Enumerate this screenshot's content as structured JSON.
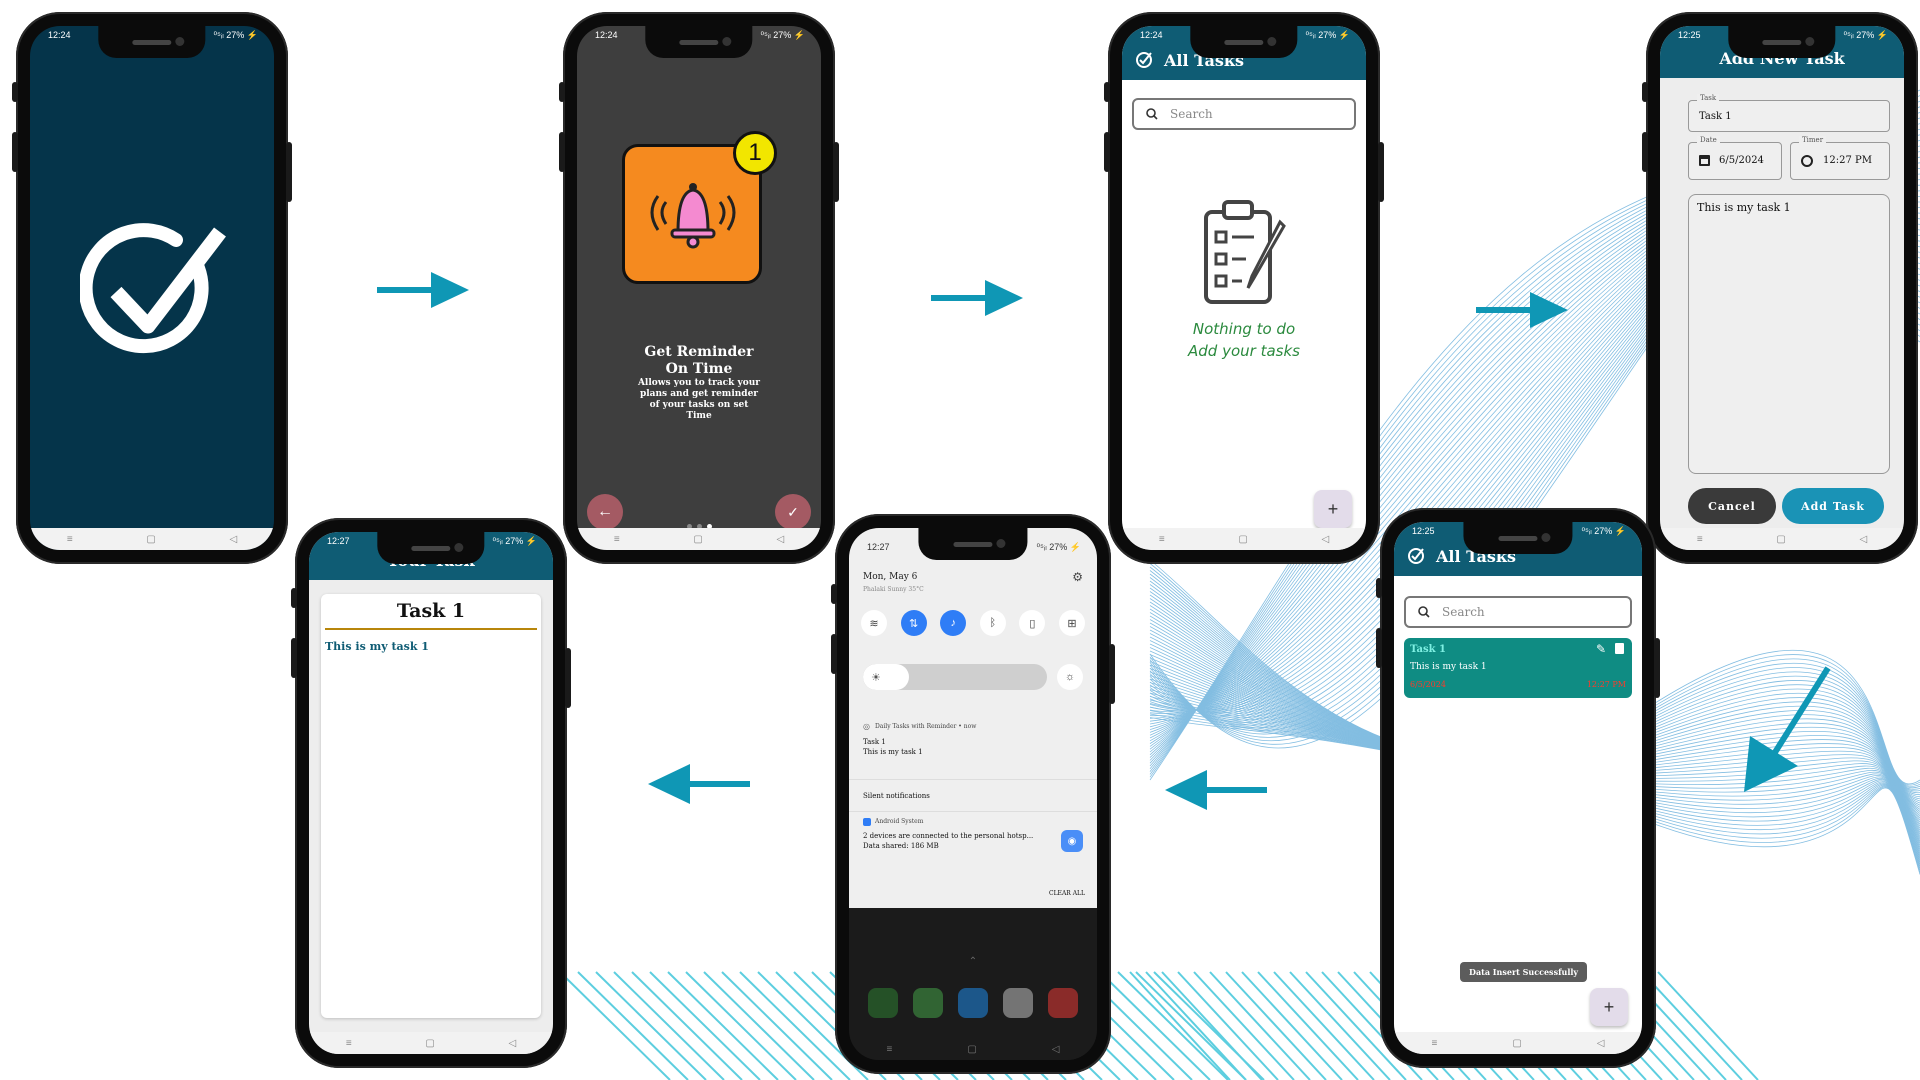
{
  "screens": {
    "splash": {
      "time": "12:24",
      "status": "⁰⁵ᵢₗ 27% ⚡"
    },
    "onboarding": {
      "time": "12:24",
      "status": "⁰⁵ᵢₗ 27% ⚡",
      "badge": "1",
      "title_line1": "Get Reminder",
      "title_line2": "On Time",
      "description": "Allows you to track your plans and get reminder of your tasks on set Time"
    },
    "empty_tasks": {
      "time": "12:24",
      "status": "⁰⁵ᵢₗ 27% ⚡",
      "title": "All Tasks",
      "search_placeholder": "Search",
      "empty_line1": "Nothing to do",
      "empty_line2": "Add your tasks",
      "fab": "+"
    },
    "add_task": {
      "time": "12:25",
      "status": "⁰⁵ᵢₗ 27% ⚡",
      "title": "Add New Task",
      "task_label": "Task",
      "task_value": "Task 1",
      "date_label": "Date",
      "date_value": "6/5/2024",
      "timer_label": "Timer",
      "timer_value": "12:27 PM",
      "description_value": "This is my task 1",
      "cancel": "Cancel",
      "add": "Add Task"
    },
    "task_list": {
      "time": "12:25",
      "status": "⁰⁵ᵢₗ 27% ⚡",
      "title": "All Tasks",
      "search_placeholder": "Search",
      "card_title": "Task 1",
      "card_desc": "This is my task 1",
      "card_date": "6/5/2024",
      "card_time": "12:27 PM",
      "toast": "Data Insert Successfully",
      "fab": "+"
    },
    "notifications": {
      "time": "12:27",
      "status": "⁰⁵ᵢₗ 27% ⚡",
      "date": "Mon, May 6",
      "weather": "Phalaki Sunny 35°C",
      "app_name": "Daily Tasks with Reminder • now",
      "notif_title": "Task 1",
      "notif_body": "This is my task 1",
      "silent": "Silent notifications",
      "system_app": "Android System",
      "system_line1": "2 devices are connected to the personal hotsp...",
      "system_line2": "Data shared: 186 MB",
      "clear_all": "CLEAR ALL"
    },
    "detail": {
      "time": "12:27",
      "status": "⁰⁵ᵢₗ 27% ⚡",
      "title": "Your Task",
      "task_title": "Task 1",
      "task_desc": "This is my task 1"
    }
  },
  "colors": {
    "splash_bg": "#05344a",
    "appbar": "#0f5c74",
    "arrow": "#0f97b5",
    "card": "#0f8c83",
    "onboarding_bg": "#3e3e3e",
    "bell_box": "#f58a1f",
    "empty_text": "#2b8a3e"
  }
}
